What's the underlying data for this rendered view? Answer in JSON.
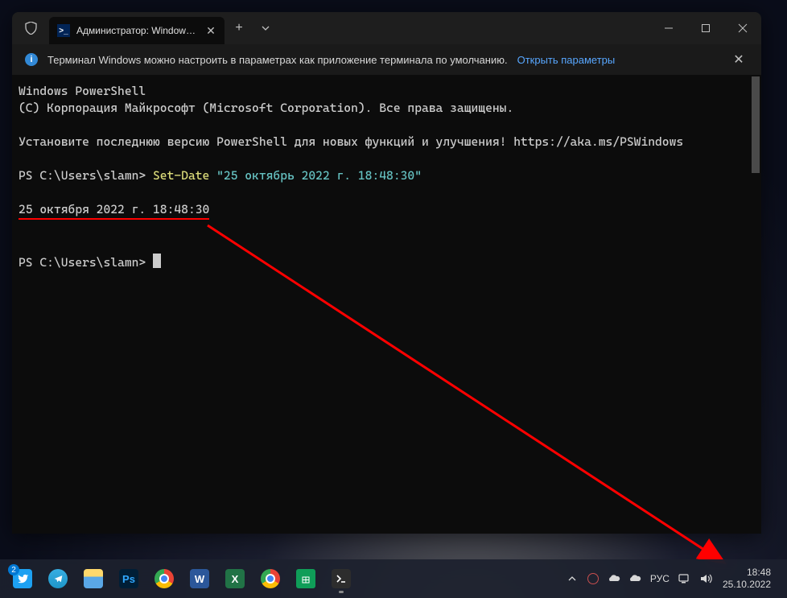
{
  "window": {
    "tab_title": "Администратор: Windows Po",
    "tab_icon_glyph": ">_"
  },
  "infobar": {
    "message": "Терминал Windows можно настроить в параметрах как приложение терминала по умолчанию.",
    "link": "Открыть параметры"
  },
  "terminal": {
    "line1": "Windows PowerShell",
    "line2": "(C) Корпорация Майкрософт (Microsoft Corporation). Все права защищены.",
    "line3": "Установите последнюю версию PowerShell для новых функций и улучшения! https://aka.ms/PSWindows",
    "prompt1": "PS C:\\Users\\slamn> ",
    "cmd1": "Set-Date",
    "arg1": " \"25 октябрь 2022 г. 18:48:30\"",
    "output": "25 октября 2022 г. 18:48:30",
    "prompt2": "PS C:\\Users\\slamn> "
  },
  "taskbar": {
    "twitter_badge": "2",
    "lang": "РУС",
    "time": "18:48",
    "date": "25.10.2022",
    "items": [
      "twitter",
      "telegram",
      "explorer",
      "photoshop",
      "chrome2",
      "word",
      "excel",
      "chrome",
      "sheets",
      "terminal"
    ]
  }
}
